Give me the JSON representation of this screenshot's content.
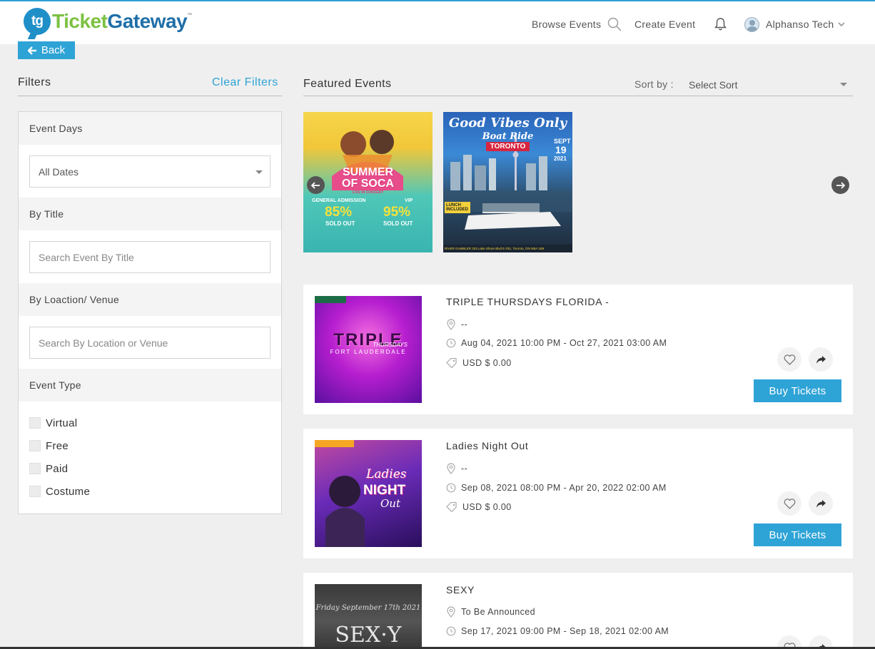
{
  "header": {
    "logo_text_a": "Ticket",
    "logo_text_b": "Gateway",
    "logo_badge": "tg",
    "logo_tm": "™",
    "browse_events": "Browse Events",
    "create_event": "Create Event",
    "user_name": "Alphanso Tech",
    "icons": [
      "search-icon",
      "bell-icon",
      "avatar",
      "chevron-down-icon"
    ]
  },
  "back_label": "Back",
  "filters": {
    "title": "Filters",
    "clear_label": "Clear Filters",
    "event_days": {
      "heading": "Event Days",
      "selected": "All Dates"
    },
    "by_title": {
      "heading": "By Title",
      "placeholder": "Search Event By Title"
    },
    "by_location": {
      "heading": "By Loaction/ Venue",
      "placeholder": "Search By Location or Venue"
    },
    "event_type": {
      "heading": "Event Type",
      "options": [
        "Virtual",
        "Free",
        "Paid",
        "Costume"
      ]
    }
  },
  "featured": {
    "title": "Featured Events",
    "sort_label": "Sort by :",
    "sort_selected": "Select Sort",
    "slides": [
      {
        "title_a": "SUMMER",
        "title_b": "OF SOCA",
        "tag": "LIVE IN CONCERT",
        "left_label": "GENERAL ADMISSION",
        "left_pct": "85%",
        "right_label": "VIP",
        "right_pct": "95%",
        "status": "SOLD OUT"
      },
      {
        "headline": "Good Vibes Only",
        "subline": "Boat Ride",
        "city": "TORONTO",
        "date_a": "SEPT",
        "date_b": "19",
        "date_c": "2021",
        "badge": "LUNCH INCLUDED",
        "footer": "RIVER GAMBLER 333 Lake Shore Blvd E #31, Toronto, ON M5A 1B6"
      }
    ]
  },
  "events": [
    {
      "title": "TRIPLE THURSDAYS FLORIDA -",
      "location": "--",
      "dates": "Aug 04, 2021 10:00 PM - Oct 27, 2021 03:00 AM",
      "price": "USD $ 0.00",
      "buy_label": "Buy Tickets",
      "thumb_a": "TRIPLE",
      "thumb_b": "THURSDAYS",
      "thumb_c": "FORT LAUDERDALE"
    },
    {
      "title": "Ladies Night Out",
      "location": "--",
      "dates": "Sep 08, 2021 08:00 PM - Apr 20, 2022 02:00 AM",
      "price": "USD $ 0.00",
      "buy_label": "Buy Tickets",
      "thumb_a": "Ladies",
      "thumb_b": "NIGHT",
      "thumb_c": "Out"
    },
    {
      "title": "SEXY",
      "location": "To Be Announced",
      "dates": "Sep 17, 2021 09:00 PM - Sep 18, 2021 02:00 AM",
      "thumb_a": "Friday September 17th 2021",
      "thumb_b": "SEX·Y"
    }
  ],
  "colors": {
    "accent": "#2ea3d6",
    "logo_green": "#7cc142",
    "logo_blue": "#1f6fa8",
    "background": "#efefef"
  }
}
